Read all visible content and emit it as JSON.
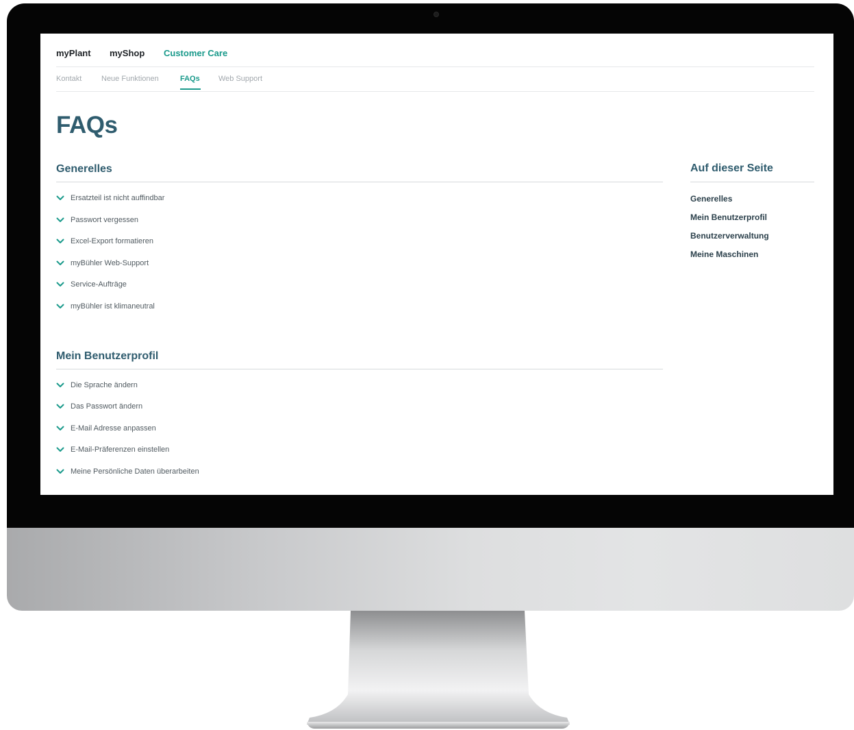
{
  "top_nav": [
    {
      "label": "myPlant"
    },
    {
      "label": "myShop"
    },
    {
      "label": "Customer Care",
      "active": true
    }
  ],
  "sub_nav": [
    {
      "label": "Kontakt"
    },
    {
      "label": "Neue Funktionen"
    },
    {
      "label": "FAQs",
      "active": true
    },
    {
      "label": "Web Support"
    }
  ],
  "page_title": "FAQs",
  "sections": [
    {
      "title": "Generelles",
      "items": [
        "Ersatzteil ist nicht auffindbar",
        "Passwort vergessen",
        "Excel-Export formatieren",
        "myBühler Web-Support",
        "Service-Aufträge",
        "myBühler ist klimaneutral"
      ]
    },
    {
      "title": "Mein Benutzerprofil",
      "items": [
        "Die Sprache ändern",
        "Das Passwort ändern",
        "E-Mail Adresse anpassen",
        "E-Mail-Präferenzen einstellen",
        "Meine Persönliche Daten überarbeiten"
      ]
    }
  ],
  "aside": {
    "title": "Auf dieser Seite",
    "links": [
      "Generelles",
      "Mein Benutzerprofil",
      "Benutzerverwaltung",
      "Meine Maschinen"
    ]
  },
  "icons": {
    "faq_toggle": "chevron-down-icon"
  },
  "colors": {
    "accent": "#1a9a8b",
    "heading": "#2f5c6e",
    "text": "#505a60",
    "muted": "#a2a8ad"
  }
}
